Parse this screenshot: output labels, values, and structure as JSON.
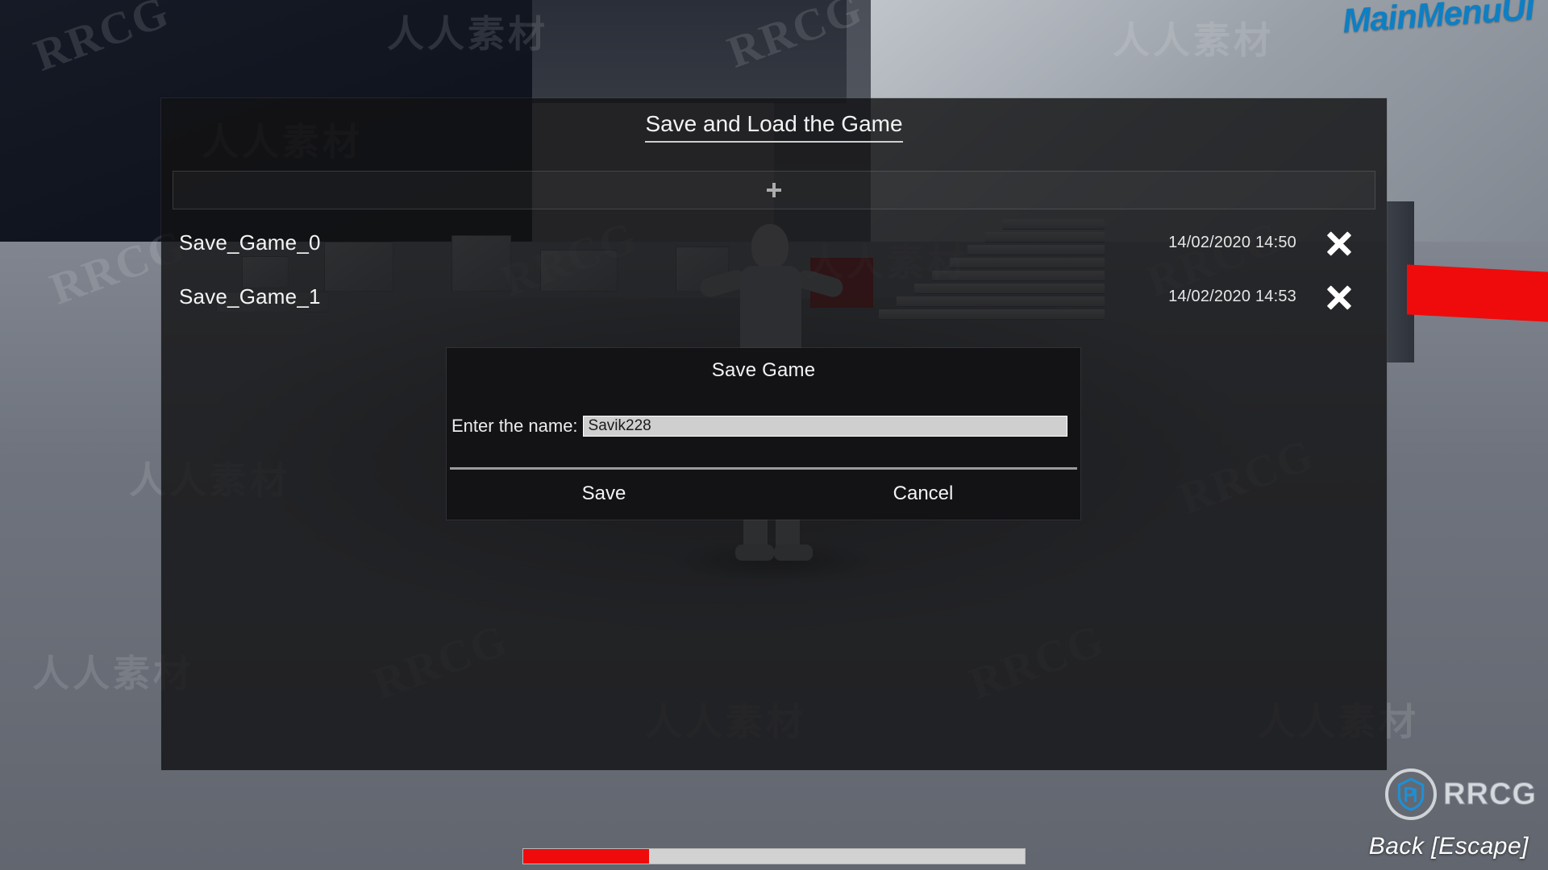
{
  "scene": {
    "editor_label": "MainMenuUI"
  },
  "panel": {
    "title": "Save and Load the Game",
    "add_button_icon": "plus-icon",
    "saves": [
      {
        "name": "Save_Game_0",
        "date": "14/02/2020 14:50",
        "delete_icon": "close-icon"
      },
      {
        "name": "Save_Game_1",
        "date": "14/02/2020 14:53",
        "delete_icon": "close-icon"
      }
    ]
  },
  "modal": {
    "title": "Save Game",
    "name_label": "Enter the name:",
    "name_value": "Savik228",
    "name_placeholder": "Enter the name",
    "save_label": "Save",
    "cancel_label": "Cancel"
  },
  "hud": {
    "back_hint": "Back [Escape]",
    "health_percent": 25,
    "health_color": "#ef0b0b",
    "health_track_color": "#d2d2d2"
  },
  "branding": {
    "logo_text": "RRCG",
    "accent_color": "#1f8fd4"
  },
  "watermarks": {
    "latin": "RRCG",
    "cjk": "人人素材"
  }
}
